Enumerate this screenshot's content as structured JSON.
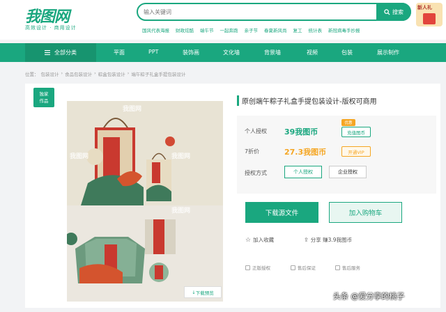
{
  "header": {
    "logo": "我图网",
    "slogan": "高效设计 · 商用设计",
    "search_placeholder": "输入关键词",
    "search_button": "搜索",
    "hotwords": [
      "国风代表海报",
      "财政炫酷",
      "端午节",
      "一起奔跑",
      "亲子节",
      "春夏新风尚",
      "复工",
      "统计表",
      "新冠病毒手抄报"
    ],
    "newbie_badge": "新人礼"
  },
  "nav": {
    "all_label": "全部分类",
    "items": [
      "平面",
      "PPT",
      "装饰画",
      "文化墙",
      "背景墙",
      "视频",
      "包装",
      "展示制作"
    ]
  },
  "breadcrumb": [
    "位置：",
    "包装设计",
    "›",
    "食品包装设计",
    "›",
    "粽盒包装设计",
    "›",
    "端午粽子礼盒手提包装设计"
  ],
  "tag": [
    "独家",
    "作品"
  ],
  "preview": {
    "watermark": "我图网",
    "download_preview": "下载预览"
  },
  "product": {
    "title": "原创端午粽子礼盒手提包装设计-版权可商用",
    "personal_label": "个人授权",
    "personal_price": "39我图币",
    "recharge": "充值图币",
    "discount_badge": "优惠",
    "vip_label": "7折价",
    "vip_price": "27.3我图币",
    "open_vip": "开通VIP",
    "license_label": "授权方式",
    "license_options": [
      "个人授权",
      "企业授权"
    ],
    "download_button": "下载源文件",
    "cart_button": "加入购物车",
    "favorite": "加入收藏",
    "share": "分享 赚3.9我图币",
    "services": [
      "正版授权",
      "售后保证",
      "售后服务"
    ]
  },
  "footer_watermark": "头条 @爱分享的桃子",
  "colors": {
    "accent": "#1aa77f",
    "orange": "#f5a623",
    "red": "#e2453c"
  }
}
